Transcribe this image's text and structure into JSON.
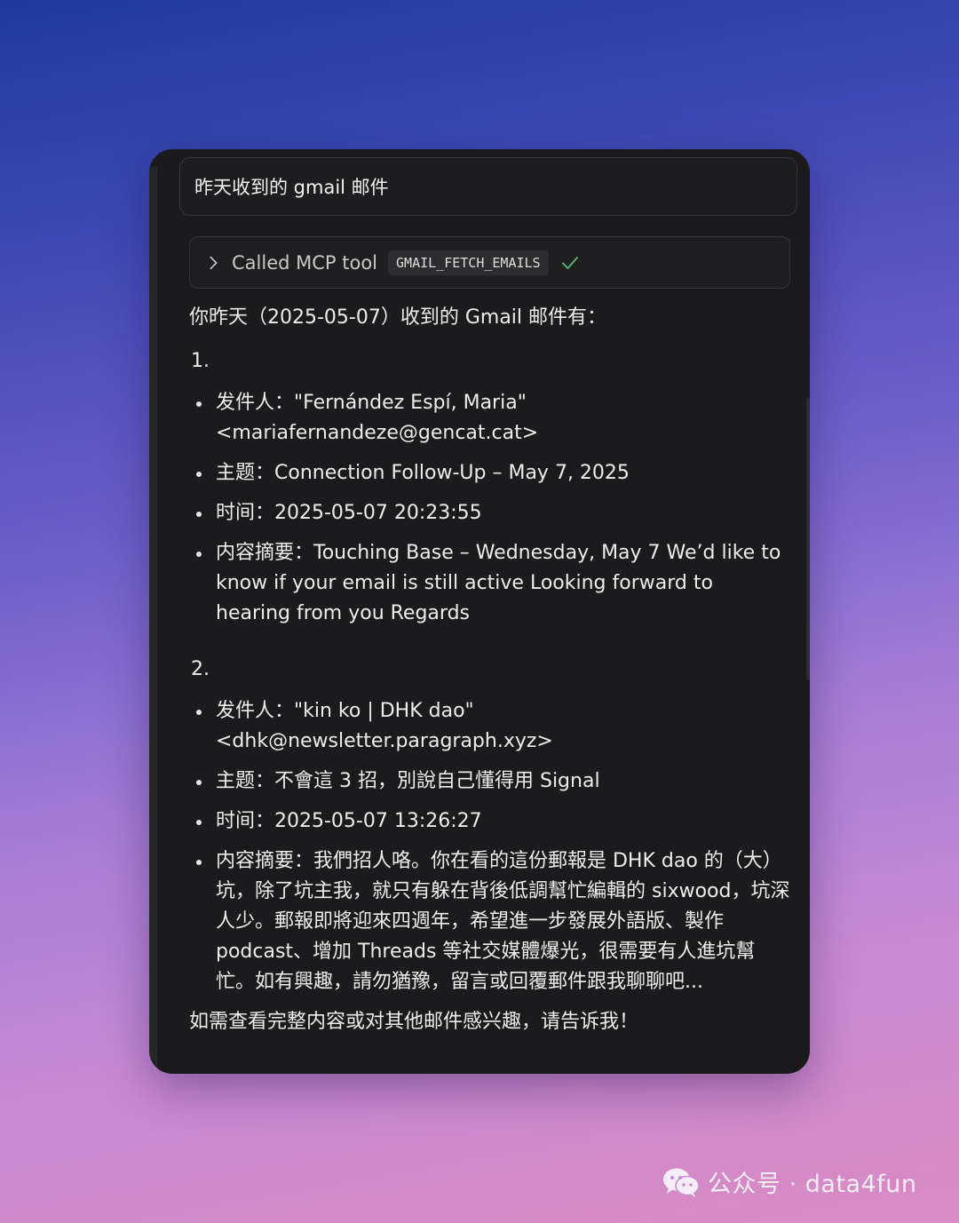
{
  "query": "昨天收到的 gmail 邮件",
  "tool_call": {
    "label": "Called MCP tool",
    "tool_name": "GMAIL_FETCH_EMAILS",
    "icon": "chevron-right-icon",
    "status_icon": "check-icon",
    "status_color": "#5fb878"
  },
  "response": {
    "intro": "你昨天（2025-05-07）收到的 Gmail 邮件有：",
    "emails": [
      {
        "number": "1.",
        "sender": "发件人：\"Fernández Espí, Maria\" <mariafernandeze@gencat.cat>",
        "subject": "主题：Connection Follow-Up – May 7, 2025",
        "time": "时间：2025-05-07 20:23:55",
        "summary": "内容摘要：Touching Base – Wednesday, May 7 We’d like to know if your email is still active Looking forward to hearing from you Regards"
      },
      {
        "number": "2.",
        "sender": "发件人：\"kin ko | DHK dao\" <dhk@newsletter.paragraph.xyz>",
        "subject": "主题：不會這 3 招，別說自己懂得用 Signal",
        "time": "时间：2025-05-07 13:26:27",
        "summary": "内容摘要：我們招人咯。你在看的這份郵報是 DHK dao 的（大）坑，除了坑主我，就只有躲在背後低調幫忙編輯的 sixwood，坑深人少。郵報即將迎來四週年，希望進一步發展外語版、製作 podcast、增加 Threads 等社交媒體爆光，很需要有人進坑幫忙。如有興趣，請勿猶豫，留言或回覆郵件跟我聊聊吧..."
      }
    ],
    "closing": "如需查看完整内容或对其他邮件感兴趣，请告诉我！"
  },
  "watermark": {
    "text": "公众号 · data4fun",
    "icon": "wechat-icon"
  }
}
